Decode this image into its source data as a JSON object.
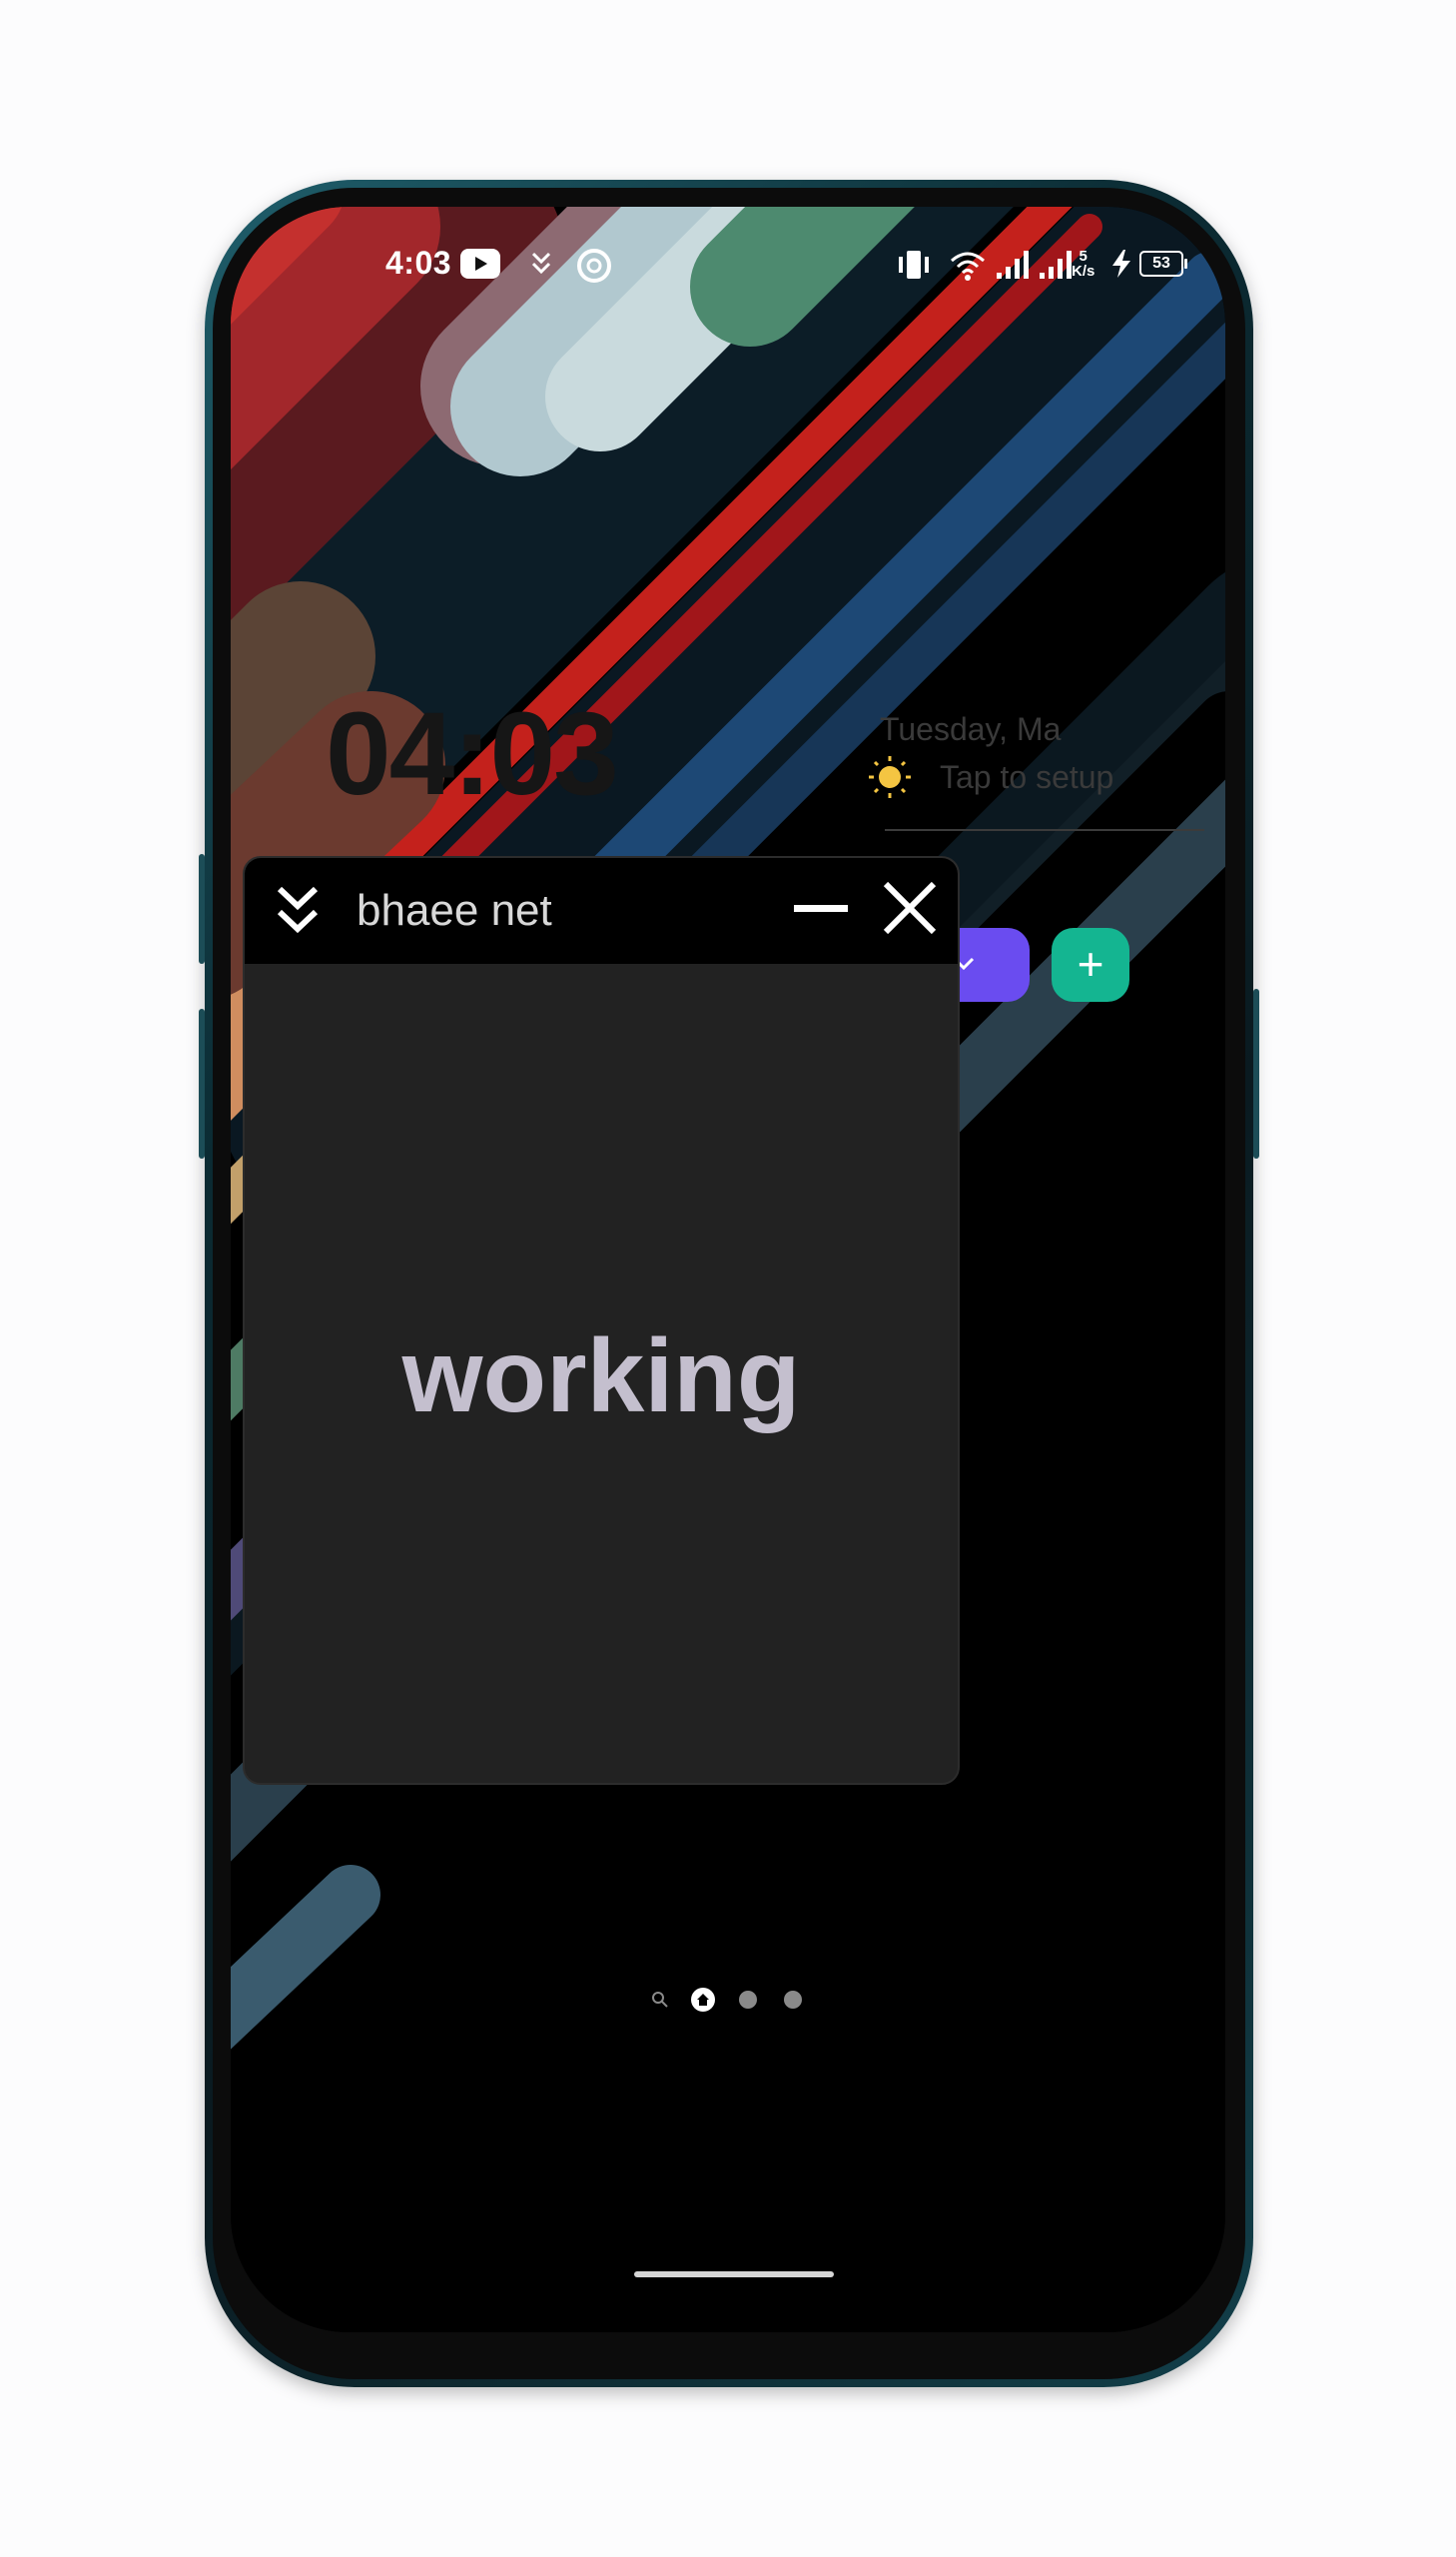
{
  "status_bar": {
    "time": "4:03",
    "network_speed_value": "5",
    "network_speed_unit": "K/s",
    "battery_level": "53",
    "icons": [
      "youtube-icon",
      "double-chevron-down-icon",
      "circle-app-icon",
      "vibrate-icon",
      "wifi-icon",
      "signal-icon",
      "signal-icon",
      "charging-icon",
      "battery-icon"
    ]
  },
  "home_widget": {
    "clock": "04:03",
    "date": "Tuesday, Ma",
    "weather": "Tap to setup",
    "weather_icon": "sun-icon"
  },
  "floating_window": {
    "title": "bhaee net",
    "body_text": "working",
    "collapse_icon": "double-chevron-down-icon",
    "minimize_icon": "minus-icon",
    "close_icon": "close-icon"
  },
  "action_buttons": {
    "dropdown_icon": "chevron-down-icon",
    "add_label": "+"
  },
  "page_indicator": {
    "pages": 3,
    "active_index": 0
  },
  "colors": {
    "purple_button": "#6a4cf0",
    "green_button": "#14b591",
    "window_bg": "#222222",
    "window_bar": "#000000"
  }
}
